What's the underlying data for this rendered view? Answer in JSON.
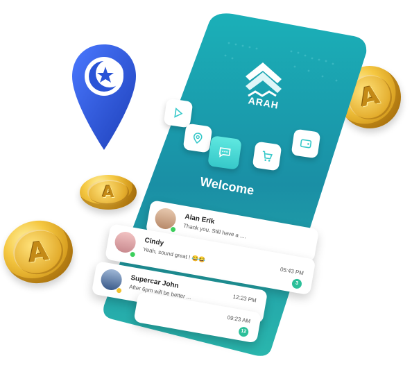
{
  "brand": {
    "name": "ARAH"
  },
  "screen": {
    "welcome": "Welcome"
  },
  "chats": [
    {
      "name": "Alan Erik",
      "message": "Thank you.  Still have a ....",
      "time": "",
      "badge": "",
      "status_color": "#3ccf5c"
    },
    {
      "name": "Cindy",
      "message": "Yeah, sound great ! 😂😂",
      "time": "05:43 PM",
      "badge": "3",
      "status_color": "#3ccf5c"
    },
    {
      "name": "Supercar John",
      "message": "After 6pm will be better ...",
      "time": "12:23 PM",
      "badge": "",
      "status_color": "#f2c230"
    },
    {
      "name": "",
      "message": "",
      "time": "09:23 AM",
      "badge": "12",
      "status_color": ""
    }
  ],
  "coin_letter": "A",
  "colors": {
    "accent": "#19a7b3",
    "pin": "#2a54d6",
    "badge": "#2bbf99"
  },
  "icons": [
    "play-icon",
    "location-icon",
    "chat-icon",
    "cart-icon",
    "wallet-icon",
    "mosque-pin-icon",
    "coin-icon"
  ]
}
